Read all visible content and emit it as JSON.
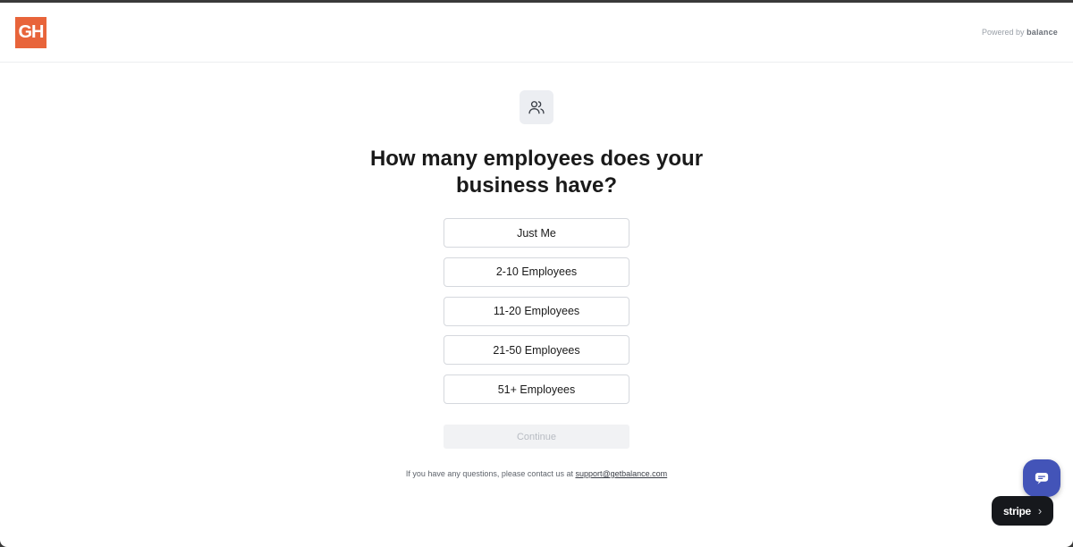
{
  "header": {
    "logo_text": "GH",
    "powered_prefix": "Powered by",
    "powered_brand": "balance"
  },
  "main": {
    "icon": "users-icon",
    "title": "How many employees does your business have?",
    "options": [
      "Just Me",
      "2-10 Employees",
      "11-20 Employees",
      "21-50 Employees",
      "51+ Employees"
    ],
    "continue_label": "Continue",
    "support_text": "If you have any questions, please contact us at",
    "support_email": "support@getbalance.com"
  },
  "widgets": {
    "chat_icon": "chat-bubble-icon",
    "stripe_label": "stripe",
    "stripe_chevron": "›"
  },
  "colors": {
    "brand_orange": "#e8643a",
    "chat_blue": "#4354b8",
    "stripe_dark": "#16181c"
  }
}
